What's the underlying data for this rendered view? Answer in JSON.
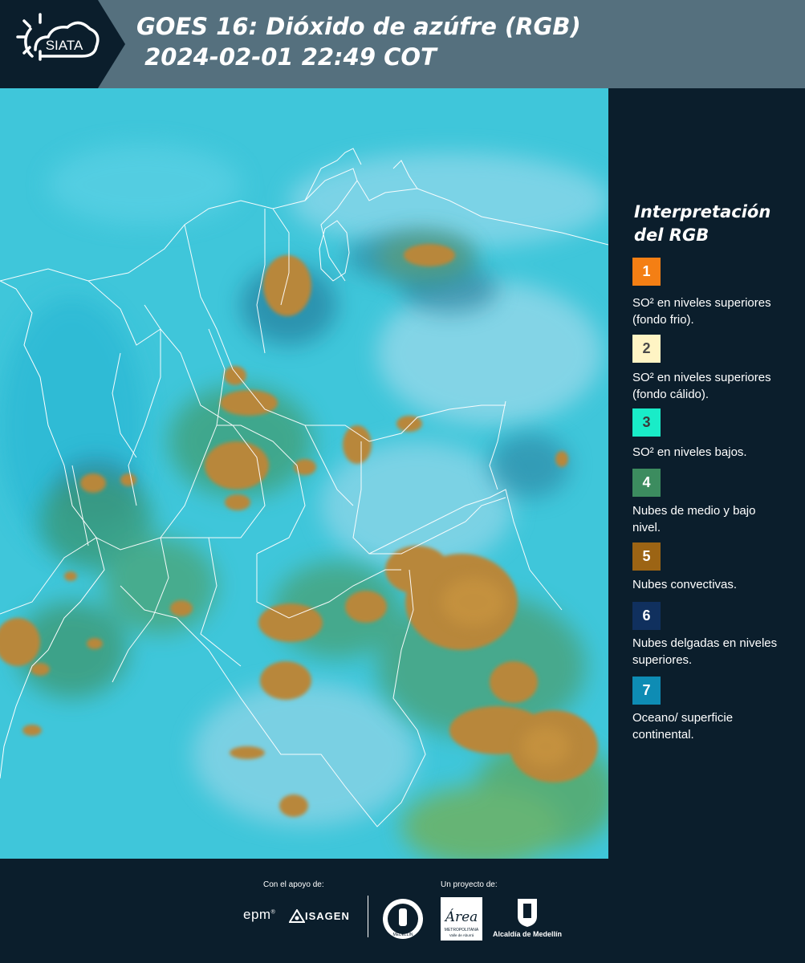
{
  "header": {
    "title": "GOES 16: Dióxido de azúfre (RGB)\n 2024-02-01 22:49 COT",
    "logo_text": "SIATA"
  },
  "legend": {
    "title": "Interpretación del RGB",
    "items": [
      {
        "number": "1",
        "color": "#f47f14",
        "number_color": "#ffffff",
        "label": "SO² en niveles superiores (fondo frio)."
      },
      {
        "number": "2",
        "color": "#fff4c4",
        "number_color": "#4a4a4a",
        "label": "SO² en niveles superiores (fondo cálido)."
      },
      {
        "number": "3",
        "color": "#19ecc8",
        "number_color": "#3a3a3a",
        "label": "SO² en niveles bajos."
      },
      {
        "number": "4",
        "color": "#3c8c5f",
        "number_color": "#ffffff",
        "label": "Nubes de medio y bajo nivel."
      },
      {
        "number": "5",
        "color": "#9c6414",
        "number_color": "#ffffff",
        "label": "Nubes convectivas."
      },
      {
        "number": "6",
        "color": "#10305e",
        "number_color": "#ffffff",
        "label": "Nubes delgadas en niveles superiores."
      },
      {
        "number": "7",
        "color": "#0e8cb4",
        "number_color": "#ffffff",
        "label": "Oceano/ superficie continental."
      }
    ]
  },
  "footer": {
    "support_label": "Con el apoyo de:",
    "project_label": "Un proyecto de:",
    "sponsors": [
      "epm",
      "ISAGEN"
    ],
    "partners": [
      "MEDELLÍN",
      "Área METROPOLITANA Valle de Aburrá",
      "Alcaldía de Medellín"
    ]
  },
  "colors": {
    "header_bg": "#55707e",
    "panel_bg": "#0b1e2c",
    "ocean": "#3cc8dc",
    "convective": "#b48232"
  }
}
